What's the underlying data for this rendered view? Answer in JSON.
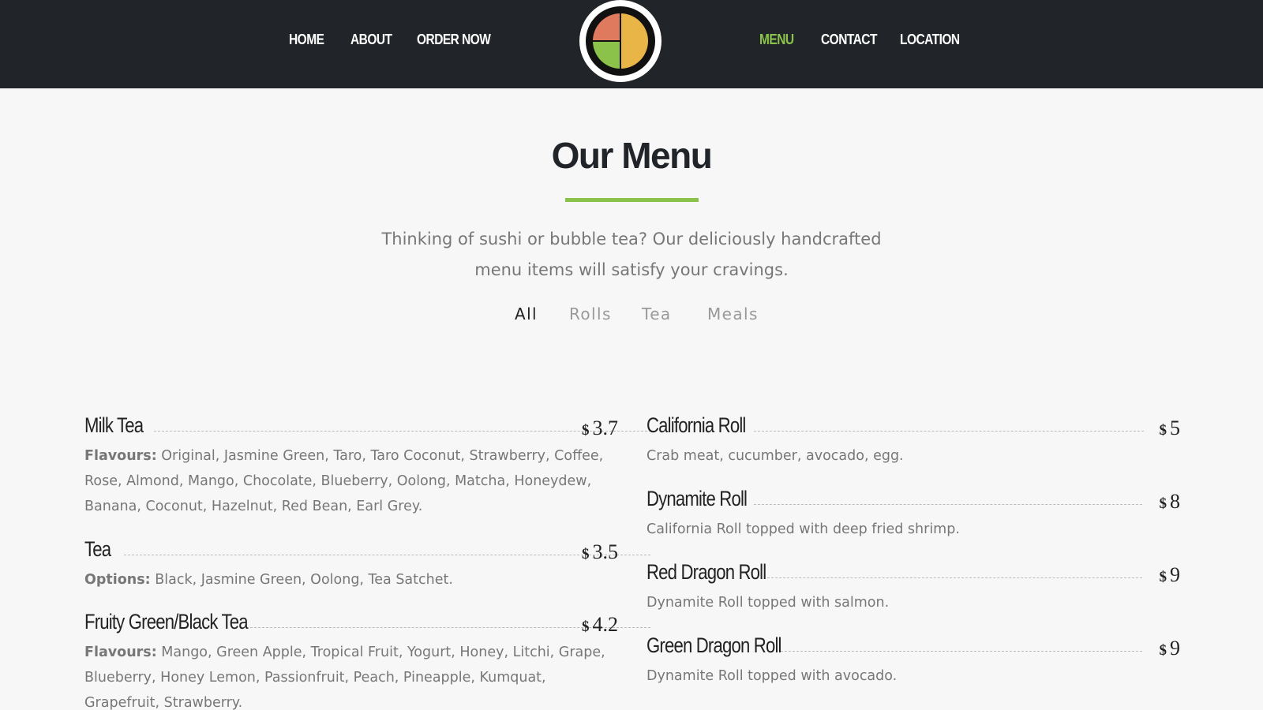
{
  "nav": {
    "left": [
      "HOME",
      "ABOUT",
      "ORDER NOW"
    ],
    "right": [
      "MENU",
      "CONTACT",
      "LOCATION"
    ],
    "active": "MENU",
    "logo_icon": "sushi-roll-logo-icon"
  },
  "colors": {
    "navbar": "#212529",
    "accent_green": "#8bc34a",
    "logo_red": "#e07a5f",
    "logo_yellow": "#e8b546",
    "background": "#f7f7f7"
  },
  "section": {
    "title": "Our Menu",
    "intro": "Thinking of sushi or bubble tea? Our deliciously handcrafted menu items will satisfy your cravings."
  },
  "filters": [
    "All",
    "Rolls",
    "Tea",
    "Meals"
  ],
  "active_filter": "All",
  "currency": "$",
  "left_items": [
    {
      "name": "Milk Tea",
      "price": "3.7",
      "label": "Flavours:",
      "desc": "Original, Jasmine Green, Taro, Taro Coconut, Strawberry, Coffee, Rose, Almond, Mango, Chocolate, Blueberry, Oolong, Matcha, Honeydew, Banana, Coconut, Hazelnut, Red Bean, Earl Grey."
    },
    {
      "name": "Tea",
      "price": "3.5",
      "label": "Options:",
      "desc": "Black, Jasmine Green, Oolong, Tea Satchet."
    },
    {
      "name": "Fruity Green/Black Tea",
      "price": "4.2",
      "label": "Flavours:",
      "desc": "Mango, Green Apple, Tropical Fruit, Yogurt, Honey, Litchi, Grape, Blueberry, Honey Lemon, Passionfruit, Peach, Pineapple, Kumquat, Grapefruit, Strawberry."
    }
  ],
  "right_items": [
    {
      "name": "California Roll",
      "price": "5",
      "desc": "Crab meat, cucumber, avocado, egg."
    },
    {
      "name": "Dynamite Roll",
      "price": "8",
      "desc": "California Roll topped with deep fried shrimp."
    },
    {
      "name": "Red Dragon Roll",
      "price": "9",
      "desc": "Dynamite Roll topped with salmon."
    },
    {
      "name": "Green Dragon Roll",
      "price": "9",
      "desc": "Dynamite Roll topped with avocado."
    }
  ]
}
